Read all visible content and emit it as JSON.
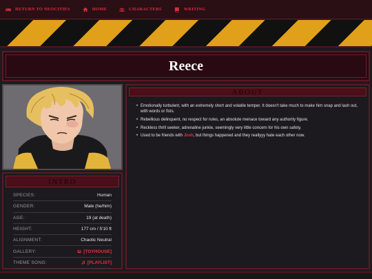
{
  "nav": {
    "items": [
      {
        "label": "Return to Neocities",
        "icon": "gamepad-icon"
      },
      {
        "label": "Home",
        "icon": "home-icon"
      },
      {
        "label": "Characters",
        "icon": "users-icon"
      },
      {
        "label": "Writing",
        "icon": "book-icon"
      }
    ]
  },
  "profile": {
    "name": "Reece"
  },
  "intro": {
    "heading": "Intro",
    "rows": [
      {
        "key": "Species:",
        "value": "Human"
      },
      {
        "key": "Gender:",
        "value": "Male (he/him)"
      },
      {
        "key": "Age:",
        "value": "19 (at death)"
      },
      {
        "key": "Height:",
        "value": "177 cm / 5'10 ft"
      },
      {
        "key": "Alignment:",
        "value": "Chaotic Neutral"
      },
      {
        "key": "Gallery:",
        "value": "[TOYHOUSE]"
      },
      {
        "key": "Theme Song:",
        "value": "[PLAYLIST]"
      }
    ]
  },
  "about": {
    "heading": "About",
    "bullets": [
      {
        "text": "Emotionally turbulent, with an extremely short and volatile temper. It doesn't take much to make him snap and lash out, with words or fists."
      },
      {
        "text": "Rebellious delinquent, no respect for rules, an absolute menace toward any authority figure."
      },
      {
        "text": "Reckless thrill seeker, adrenaline junkie, seemingly very little concern for his own safety."
      },
      {
        "pre": "Used to be friends with ",
        "link": "Josh",
        "post": ", but things happened and they reallyyy hate each other now."
      }
    ]
  },
  "colors": {
    "accent": "#d2313c",
    "panel_border": "#5a1a24",
    "hazard_yellow": "#e0a019"
  }
}
